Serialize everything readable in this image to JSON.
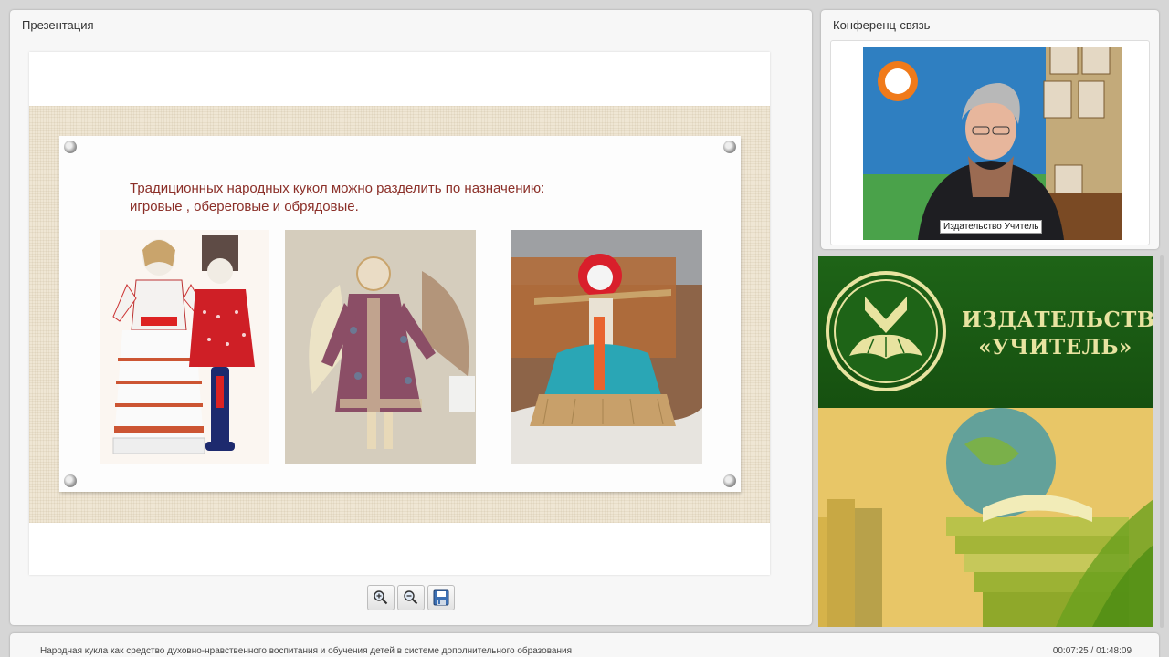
{
  "presentation": {
    "title": "Презентация",
    "slide": {
      "heading_line1": "Традиционных народных кукол можно разделить по назначению:",
      "heading_line2": "игровые , обереговые и обрядовые."
    },
    "toolbar": {
      "zoom_in_icon": "zoom-in-icon",
      "zoom_out_icon": "zoom-out-icon",
      "save_icon": "save-icon"
    }
  },
  "conference": {
    "title": "Конференц-связь",
    "participant_label": "Издательство Учитель"
  },
  "publisher": {
    "name_line1": "ИЗДАТЕЛЬСТВО",
    "name_line2": "«УЧИТЕЛЬ»",
    "brand_color": "#1e6417",
    "text_color": "#e8e3a0"
  },
  "footer": {
    "course_title": "Народная кукла как средство духовно-нравственного воспитания и обучения детей в системе дополнительного образования",
    "time": "00:07:25 / 01:48:09"
  }
}
